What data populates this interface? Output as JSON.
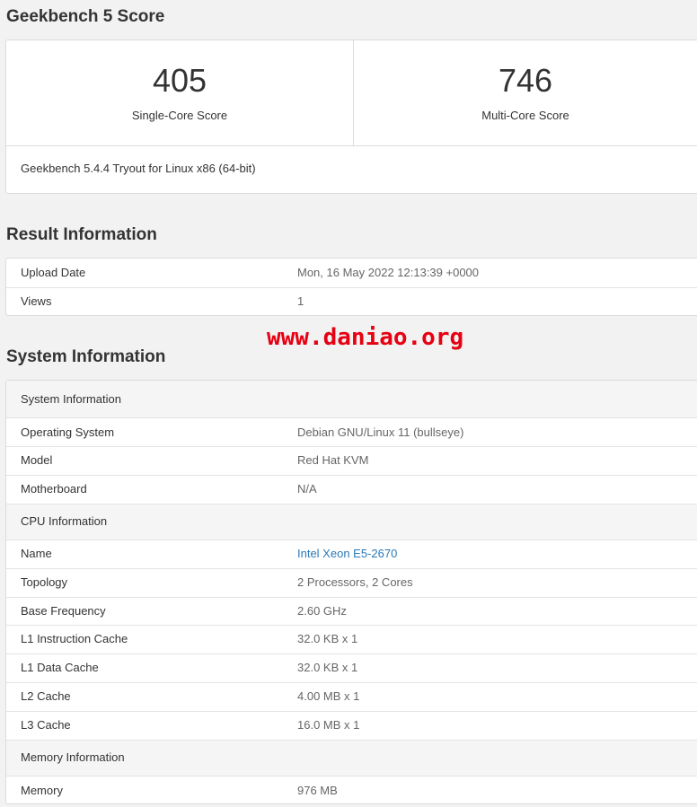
{
  "score_section": {
    "title": "Geekbench 5 Score",
    "single_core": {
      "value": "405",
      "label": "Single-Core Score"
    },
    "multi_core": {
      "value": "746",
      "label": "Multi-Core Score"
    },
    "footer": "Geekbench 5.4.4 Tryout for Linux x86 (64-bit)"
  },
  "result_section": {
    "title": "Result Information",
    "rows": [
      {
        "key": "Upload Date",
        "value": "Mon, 16 May 2022 12:13:39 +0000"
      },
      {
        "key": "Views",
        "value": "1"
      }
    ]
  },
  "watermark": "www.daniao.org",
  "system_section": {
    "title": "System Information",
    "groups": [
      {
        "header": "System Information",
        "rows": [
          {
            "key": "Operating System",
            "value": "Debian GNU/Linux 11 (bullseye)"
          },
          {
            "key": "Model",
            "value": "Red Hat KVM"
          },
          {
            "key": "Motherboard",
            "value": "N/A"
          }
        ]
      },
      {
        "header": "CPU Information",
        "rows": [
          {
            "key": "Name",
            "value": "Intel Xeon E5-2670"
          },
          {
            "key": "Topology",
            "value": "2 Processors, 2 Cores"
          },
          {
            "key": "Base Frequency",
            "value": "2.60 GHz"
          },
          {
            "key": "L1 Instruction Cache",
            "value": "32.0 KB x 1"
          },
          {
            "key": "L1 Data Cache",
            "value": "32.0 KB x 1"
          },
          {
            "key": "L2 Cache",
            "value": "4.00 MB x 1"
          },
          {
            "key": "L3 Cache",
            "value": "16.0 MB x 1"
          }
        ]
      },
      {
        "header": "Memory Information",
        "rows": [
          {
            "key": "Memory",
            "value": "976 MB"
          }
        ]
      }
    ]
  },
  "colors": {
    "link": "#2a7ab8",
    "watermark": "#e60012",
    "background": "#f2f2f2"
  }
}
